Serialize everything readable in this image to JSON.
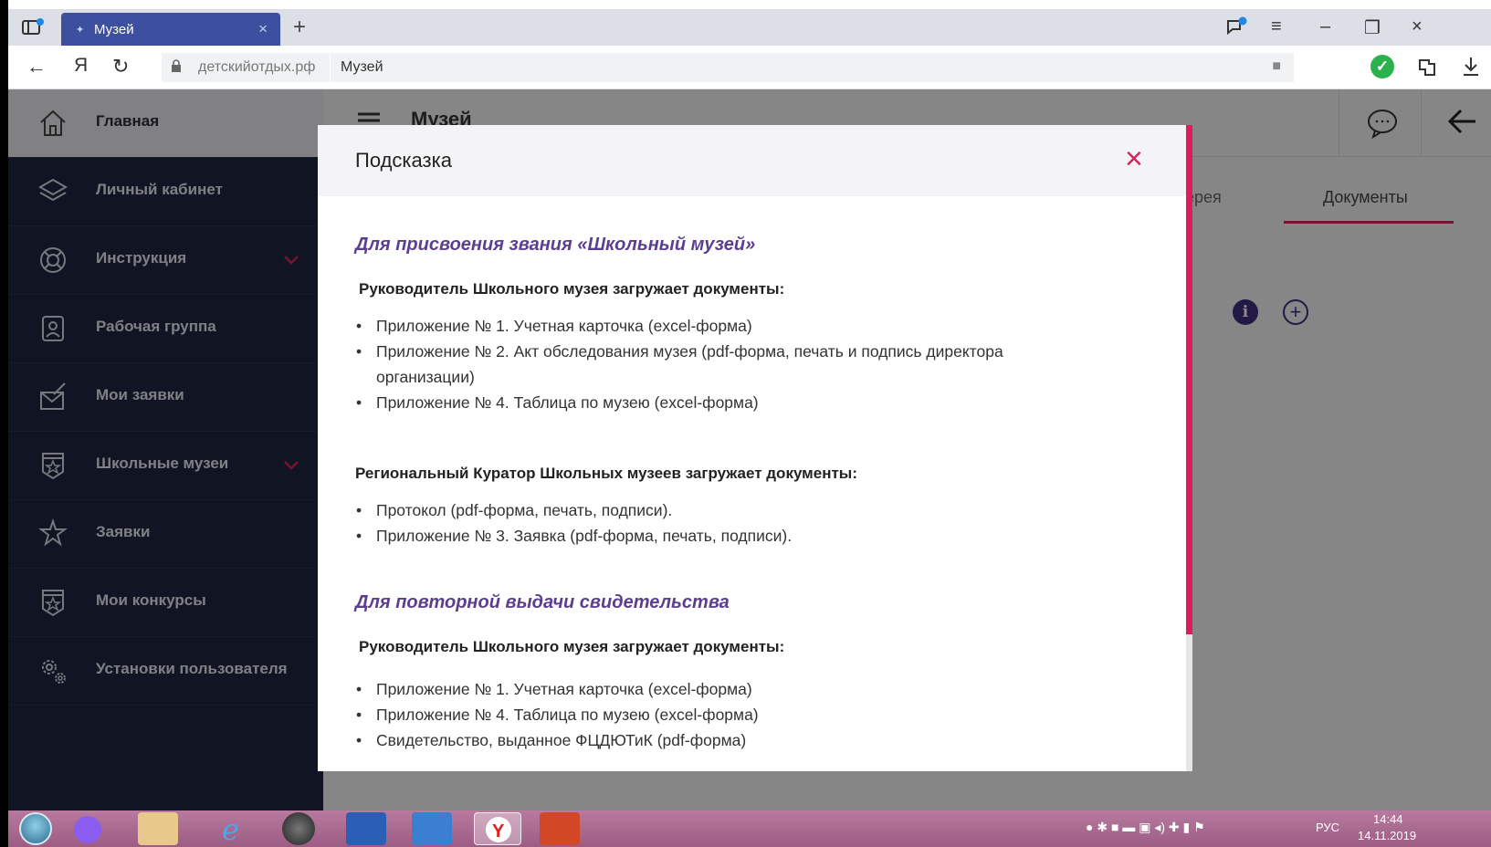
{
  "browser": {
    "tab_title": "Музей",
    "tab_close": "×",
    "new_tab": "+",
    "url_domain": "детскийотдых.рф",
    "url_page_title": "Музей",
    "nav_back": "←",
    "nav_yandex": "Я",
    "nav_reload": "↻",
    "window_controls": [
      "≡",
      "–",
      "❐",
      "×"
    ]
  },
  "sidebar": {
    "items": [
      {
        "label": "Главная",
        "icon": "home-icon",
        "active": true
      },
      {
        "label": "Личный кабинет",
        "icon": "layers-icon"
      },
      {
        "label": "Инструкция",
        "icon": "lifebuoy-icon",
        "has_chevron": true
      },
      {
        "label": "Рабочая группа",
        "icon": "person-badge-icon"
      },
      {
        "label": "Мои заявки",
        "icon": "envelope-edit-icon"
      },
      {
        "label": "Школьные музеи",
        "icon": "star-shield-icon",
        "has_chevron": true
      },
      {
        "label": "Заявки",
        "icon": "star-burst-icon"
      },
      {
        "label": "Мои конкурсы",
        "icon": "star-shield-icon"
      },
      {
        "label": "Установки пользователя",
        "icon": "gears-icon"
      }
    ]
  },
  "app": {
    "header_title": "Музей",
    "tabs": [
      {
        "label": "ерея"
      },
      {
        "label": "Документы",
        "active": true
      }
    ]
  },
  "modal": {
    "title": "Подсказка",
    "close": "×",
    "section1_title": "Для присвоения звания «Школьный музей»",
    "section1_sub1": "Руководитель Школьного музея загружает документы:",
    "section1_list1": [
      "Приложение № 1. Учетная карточка (excel-форма)",
      "Приложение № 2. Акт обследования музея (pdf-форма, печать и подпись директора",
      "организации)",
      "Приложение № 4. Таблица по музею (excel-форма)"
    ],
    "section1_sub2": "Региональный Куратор Школьных музеев загружает документы:",
    "section1_list2": [
      "Протокол (pdf-форма, печать, подписи).",
      "Приложение № 3. Заявка (pdf-форма, печать, подписи)."
    ],
    "section2_title": "Для повторной выдачи свидетельства",
    "section2_sub1": "Руководитель Школьного музея загружает документы:",
    "section2_list1": [
      "Приложение № 1. Учетная карточка (excel-форма)",
      " Приложение № 4. Таблица по музею (excel-форма)",
      "Свидетельство, выданное ФЦДЮТиК (pdf-форма)"
    ]
  },
  "taskbar": {
    "lang": "РУС",
    "time": "14:44",
    "date": "14.11.2019"
  },
  "colors": {
    "accent": "#d6245a",
    "sidebar_bg": "#1e2640",
    "heading_purple": "#5b3e90"
  }
}
